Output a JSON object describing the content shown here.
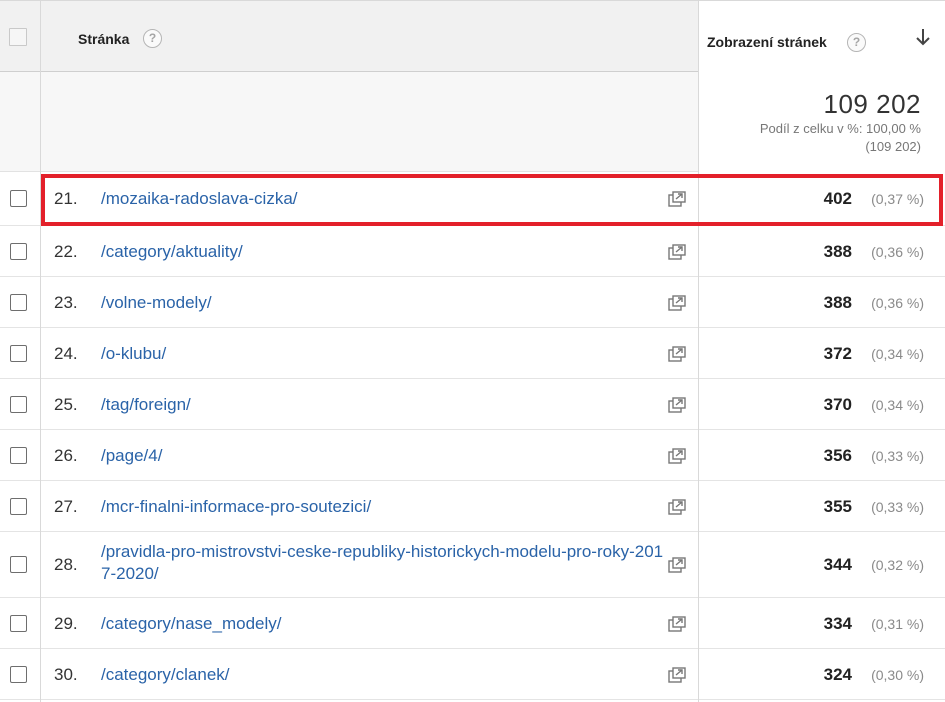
{
  "header": {
    "page_label": "Stránka",
    "views_label": "Zobrazení stránek",
    "help_glyph": "?",
    "sort_icon": "arrow-down-icon"
  },
  "totals": {
    "value": "109 202",
    "share_label": "Podíl z celku v %: 100,00 %",
    "share_total": "(109 202)"
  },
  "rows": [
    {
      "num": "21.",
      "page": "/mozaika-radoslava-cizka/",
      "views": "402",
      "pct": "(0,37 %)"
    },
    {
      "num": "22.",
      "page": "/category/aktuality/",
      "views": "388",
      "pct": "(0,36 %)"
    },
    {
      "num": "23.",
      "page": "/volne-modely/",
      "views": "388",
      "pct": "(0,36 %)"
    },
    {
      "num": "24.",
      "page": "/o-klubu/",
      "views": "372",
      "pct": "(0,34 %)"
    },
    {
      "num": "25.",
      "page": "/tag/foreign/",
      "views": "370",
      "pct": "(0,34 %)"
    },
    {
      "num": "26.",
      "page": "/page/4/",
      "views": "356",
      "pct": "(0,33 %)"
    },
    {
      "num": "27.",
      "page": "/mcr-finalni-informace-pro-soutezici/",
      "views": "355",
      "pct": "(0,33 %)"
    },
    {
      "num": "28.",
      "page": "/pravidla-pro-mistrovstvi-ceske-republiky-historickych-modelu-pro-roky-2017-2020/",
      "views": "344",
      "pct": "(0,32 %)"
    },
    {
      "num": "29.",
      "page": "/category/nase_modely/",
      "views": "334",
      "pct": "(0,31 %)"
    },
    {
      "num": "30.",
      "page": "/category/clanek/",
      "views": "324",
      "pct": "(0,30 %)"
    }
  ],
  "colors": {
    "link": "#2a63a8",
    "highlight": "#e3202a"
  },
  "highlighted_row": 0
}
